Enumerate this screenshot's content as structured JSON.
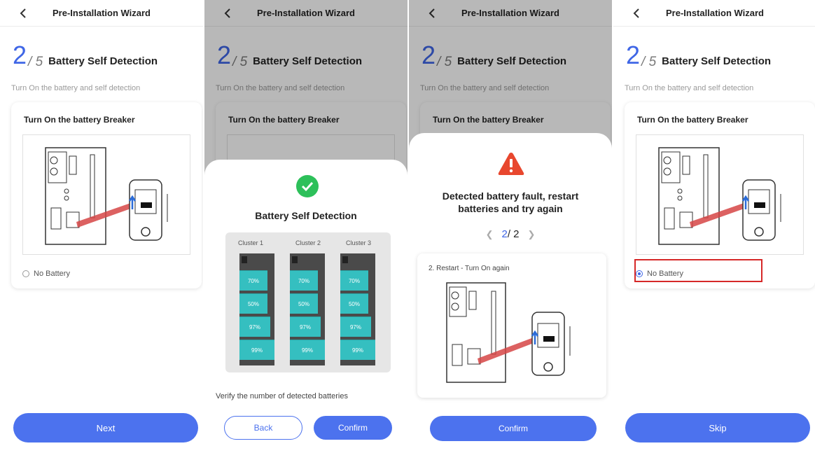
{
  "header_title": "Pre-Installation Wizard",
  "step": {
    "current": "2",
    "total": "/ 5",
    "title": "Battery Self Detection"
  },
  "subtitle": "Turn On the battery and self detection",
  "card_title": "Turn On the battery Breaker",
  "no_battery_label": "No Battery",
  "screen1": {
    "next_label": "Next",
    "no_battery_selected": false
  },
  "screen2": {
    "modal_title": "Battery Self Detection",
    "clusters": [
      {
        "label": "Cluster 1",
        "batteries": [
          "70%",
          "50%",
          "97%",
          "99%"
        ]
      },
      {
        "label": "Cluster 2",
        "batteries": [
          "70%",
          "50%",
          "97%",
          "99%"
        ]
      },
      {
        "label": "Cluster 3",
        "batteries": [
          "70%",
          "50%",
          "97%",
          "99%"
        ]
      }
    ],
    "verify_text": "Verify the number of detected batteries",
    "back_label": "Back",
    "confirm_label": "Confirm"
  },
  "screen3": {
    "message_line1": "Detected battery fault, restart",
    "message_line2": "batteries and try again",
    "pager_current": "2",
    "pager_total": "/ 2",
    "step_text": "2. Restart - Turn On again",
    "confirm_label": "Confirm"
  },
  "screen4": {
    "skip_label": "Skip",
    "no_battery_selected": true
  },
  "colors": {
    "accent": "#4C72EE",
    "success": "#2DC05A",
    "warning": "#E8472E",
    "battery": "#35BFC0",
    "highlight": "#D62828"
  }
}
